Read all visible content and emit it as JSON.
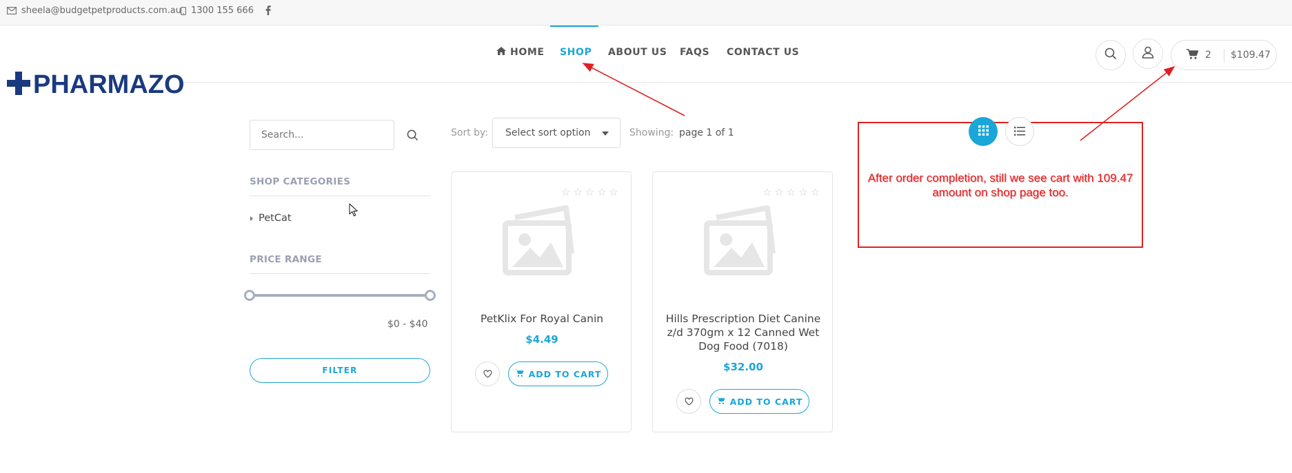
{
  "topbar": {
    "email": "sheela@budgetpetproducts.com.au",
    "phone": "1300 155 666",
    "icons": [
      "mail-icon",
      "phone-icon",
      "facebook-icon"
    ]
  },
  "brand": {
    "name": "PHARMAZO",
    "color": "#1a3a80"
  },
  "nav": {
    "home": "HOME",
    "shop": "SHOP",
    "about": "ABOUT US",
    "faqs": "FAQS",
    "contact": "CONTACT US",
    "active": "SHOP"
  },
  "header_tools": {
    "cart_count": "2",
    "cart_total": "$109.47",
    "icons": [
      "search-icon",
      "user-icon",
      "cart-icon"
    ]
  },
  "sidebar": {
    "search_placeholder": "Search...",
    "categories_heading": "SHOP CATEGORIES",
    "categories": [
      {
        "label": "PetCat"
      }
    ],
    "price_heading": "PRICE RANGE",
    "price_range_label": "$0 -  $40",
    "price_min": 0,
    "price_max": 40,
    "filter_label": "FILTER"
  },
  "toolbar": {
    "sort_label": "Sort by:",
    "sort_value": "Select sort option",
    "showing_label": "Showing:",
    "showing_value": "page 1 of 1",
    "view_modes": [
      "grid",
      "list"
    ],
    "active_view": "grid"
  },
  "products": [
    {
      "title": "PetKlix For Royal Canin",
      "price": "$4.49",
      "rating": 0,
      "add_label": "ADD TO CART"
    },
    {
      "title": "Hills Prescription Diet Canine z/d 370gm x 12 Canned Wet Dog Food (7018)",
      "price": "$32.00",
      "rating": 0,
      "add_label": "ADD TO CART"
    }
  ],
  "annotation": {
    "text": "After order completion, still we see cart with 109.47 amount on shop page too.",
    "color": "#e02020"
  },
  "colors": {
    "accent": "#1ba6d8",
    "muted_heading": "#9aa0b0"
  }
}
